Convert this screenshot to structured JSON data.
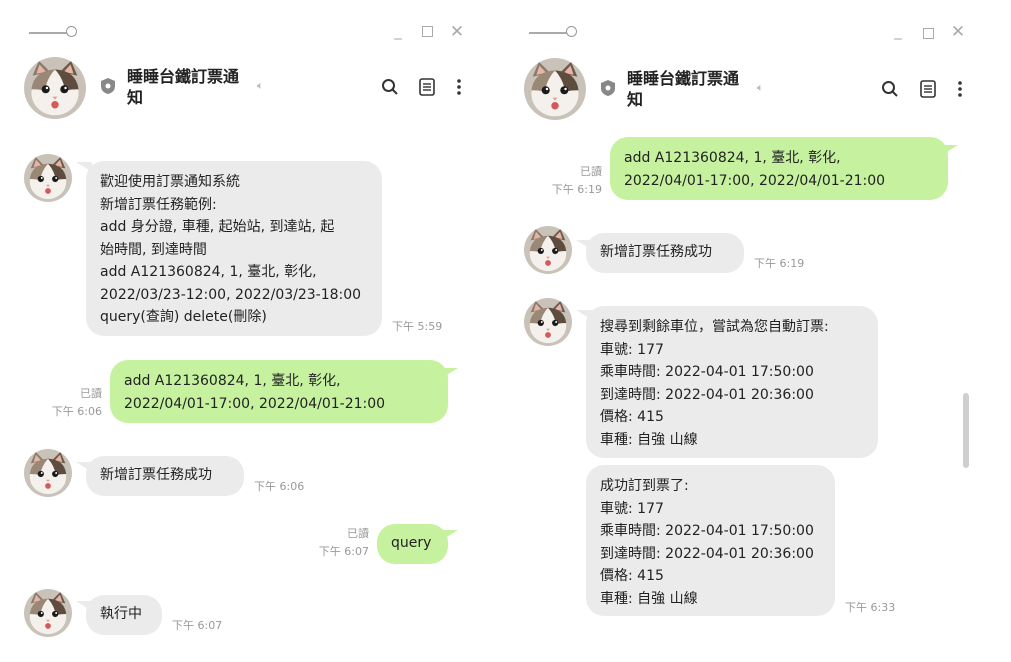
{
  "win1": {
    "title": "睡睡台鐵訂票通\n知",
    "messages": [
      {
        "text": "歡迎使用訂票通知系統\n新增訂票任務範例:\nadd 身分證, 車種, 起始站, 到達站, 起\n始時間, 到達時間\nadd A121360824, 1, 臺北, 彰化,\n2022/03/23-12:00, 2022/03/23-18:00\nquery(查詢) delete(刪除)",
        "time": "下午 5:59"
      },
      {
        "text": "add A121360824, 1, 臺北, 彰化,\n2022/04/01-17:00, 2022/04/01-21:00",
        "read": "已讀",
        "time": "下午 6:06"
      },
      {
        "text": "新增訂票任務成功",
        "time": "下午 6:06"
      },
      {
        "text": "query",
        "read": "已讀",
        "time": "下午 6:07"
      },
      {
        "text": "執行中",
        "time": "下午 6:07"
      }
    ]
  },
  "win2": {
    "title": "睡睡台鐵訂票通\n知",
    "messages": [
      {
        "text": "add A121360824, 1, 臺北, 彰化,\n2022/04/01-17:00, 2022/04/01-21:00",
        "read": "已讀",
        "time": "下午 6:19"
      },
      {
        "text": "新增訂票任務成功",
        "time": "下午 6:19"
      },
      {
        "text": "搜尋到剩餘車位，嘗試為您自動訂票:\n車號: 177\n乘車時間: 2022-04-01 17:50:00\n到達時間: 2022-04-01 20:36:00\n價格: 415\n車種: 自強 山線"
      },
      {
        "text": "成功訂到票了:\n車號: 177\n乘車時間: 2022-04-01 17:50:00\n到達時間: 2022-04-01 20:36:00\n價格: 415\n車種: 自強 山線",
        "time": "下午 6:33"
      }
    ]
  },
  "icons": {
    "pin": "pin-icon",
    "minimize": "minimize-icon",
    "maximize": "maximize-icon",
    "close": "close-icon",
    "shield": "shield-icon",
    "mute": "mute-icon",
    "search": "search-icon",
    "notes": "notes-icon",
    "more": "more-icon"
  },
  "colors": {
    "sent_bubble": "#c6f2a0",
    "received_bubble": "#ebebeb",
    "meta_text": "#999999"
  }
}
